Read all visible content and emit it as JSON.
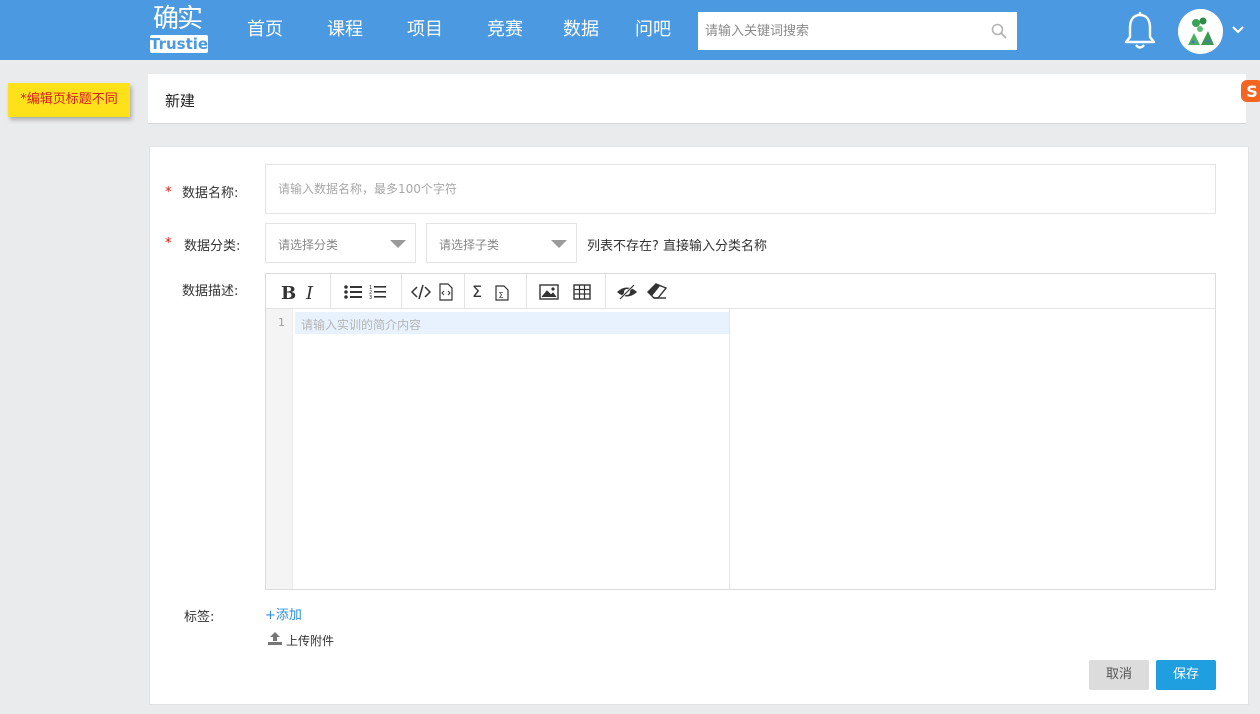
{
  "header": {
    "logo_top": "确实",
    "logo_bottom": "Trustie",
    "nav": [
      "首页",
      "课程",
      "项目",
      "竞赛",
      "数据",
      "问吧"
    ],
    "search_placeholder": "请输入关键词搜索"
  },
  "note": "*编辑页标题不同",
  "page": {
    "title": "新建"
  },
  "form": {
    "name_label": "数据名称:",
    "name_placeholder": "请输入数据名称，最多100个字符",
    "category_label": "数据分类:",
    "category_placeholder": "请选择分类",
    "subcategory_placeholder": "请选择子类",
    "category_hint": "列表不存在? 直接输入分类名称",
    "desc_label": "数据描述:",
    "desc_placeholder": "请输入实训的简介内容",
    "line_number": "1",
    "tag_label": "标签:",
    "tag_add": "+添加",
    "upload": "上传附件",
    "cancel": "取消",
    "save": "保存"
  },
  "toolbar_icons": [
    "bold-icon",
    "italic-icon",
    "bullet-list-icon",
    "numbered-list-icon",
    "code-inline-icon",
    "code-block-icon",
    "sum-icon",
    "formula-icon",
    "image-icon",
    "table-icon",
    "preview-toggle-icon",
    "eraser-icon"
  ],
  "colors": {
    "header": "#4b9ae1",
    "save": "#1f9ee0",
    "note": "#ffe11a",
    "required": "#e11111"
  }
}
